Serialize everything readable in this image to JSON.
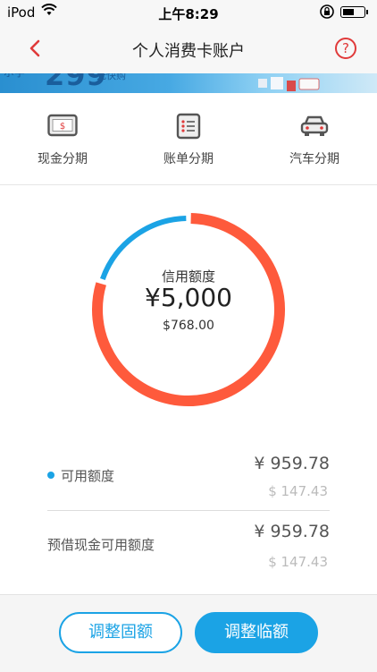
{
  "status": {
    "carrier": "iPod",
    "time": "上午8:29"
  },
  "nav": {
    "title": "个人消费卡账户",
    "help": "?"
  },
  "banner": {
    "text_left": "ポ字",
    "number": "299",
    "sub": "元快购"
  },
  "quick_menu": [
    {
      "label": "现金分期",
      "icon": "cash-card-icon"
    },
    {
      "label": "账单分期",
      "icon": "bill-list-icon"
    },
    {
      "label": "汽车分期",
      "icon": "car-icon"
    }
  ],
  "credit": {
    "label": "信用额度",
    "amount_cny": "¥5,000",
    "amount_usd": "$768.00",
    "used_fraction": 0.8,
    "available_fraction": 0.2
  },
  "available": {
    "label": "可用额度",
    "cny": "¥ 959.78",
    "usd": "$ 147.43"
  },
  "cash_available": {
    "label": "预借现金可用额度",
    "cny": "¥ 959.78",
    "usd": "$ 147.43"
  },
  "buttons": {
    "adjust_fixed": "调整固额",
    "adjust_temp": "调整临额"
  },
  "colors": {
    "accent_blue": "#1ba3e5",
    "used_red": "#fe5a3c",
    "nav_red": "#e03a3a"
  }
}
